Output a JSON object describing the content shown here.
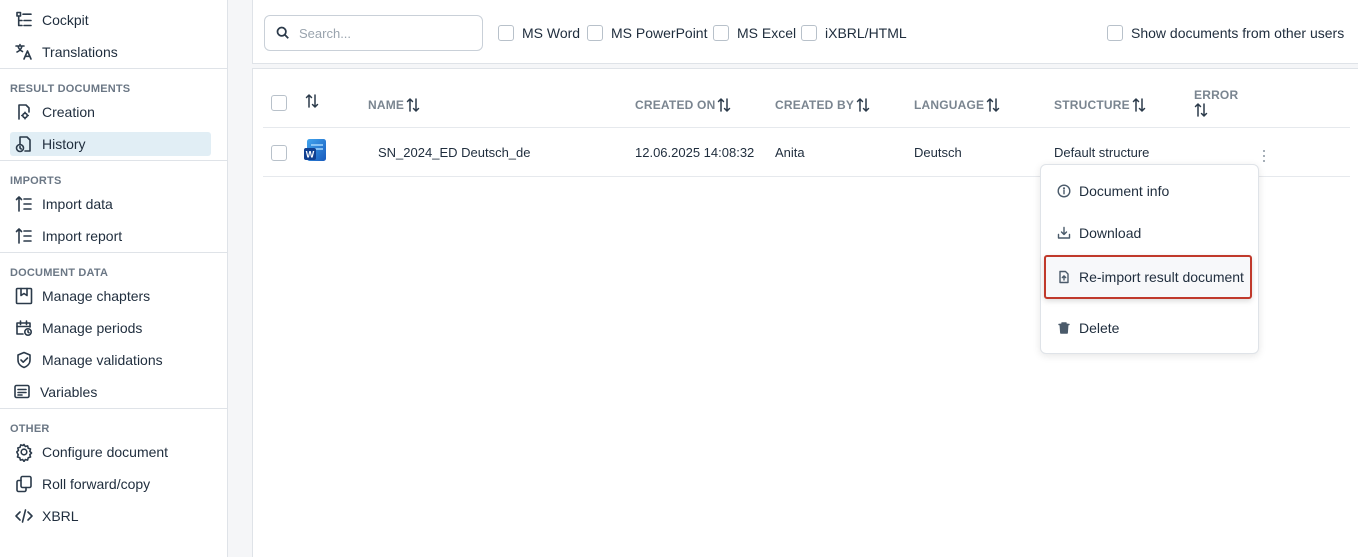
{
  "sidebar": {
    "top_items": [
      {
        "label": "Cockpit",
        "icon": "tree-list-icon"
      },
      {
        "label": "Translations",
        "icon": "translate-icon"
      }
    ],
    "sections": [
      {
        "title": "RESULT DOCUMENTS",
        "items": [
          {
            "label": "Creation",
            "icon": "document-gear-icon"
          },
          {
            "label": "History",
            "icon": "document-history-icon",
            "active": true
          }
        ]
      },
      {
        "title": "IMPORTS",
        "items": [
          {
            "label": "Import data",
            "icon": "import-list-icon"
          },
          {
            "label": "Import report",
            "icon": "import-list-icon"
          }
        ]
      },
      {
        "title": "DOCUMENT DATA",
        "items": [
          {
            "label": "Manage chapters",
            "icon": "bookmark-icon"
          },
          {
            "label": "Manage periods",
            "icon": "calendar-clock-icon"
          },
          {
            "label": "Manage validations",
            "icon": "shield-check-icon"
          },
          {
            "label": "Variables",
            "icon": "variables-icon"
          }
        ]
      },
      {
        "title": "OTHER",
        "items": [
          {
            "label": "Configure document",
            "icon": "gear-icon"
          },
          {
            "label": "Roll forward/copy",
            "icon": "copy-icon"
          },
          {
            "label": "XBRL",
            "icon": "code-icon"
          }
        ]
      }
    ]
  },
  "toolbar": {
    "search_placeholder": "Search...",
    "filters": [
      "MS Word",
      "MS PowerPoint",
      "MS Excel",
      "iXBRL/HTML"
    ],
    "show_other_users": "Show documents from other users"
  },
  "table": {
    "headers": [
      "NAME",
      "CREATED ON",
      "CREATED BY",
      "LANGUAGE",
      "STRUCTURE",
      "ERROR"
    ],
    "rows": [
      {
        "name": "SN_2024_ED Deutsch_de",
        "created_on": "12.06.2025 14:08:32",
        "created_by": "Anita",
        "language": "Deutsch",
        "structure": "Default structure",
        "error": ""
      }
    ]
  },
  "context_menu": {
    "items": [
      {
        "label": "Document info",
        "icon": "info-icon"
      },
      {
        "label": "Download",
        "icon": "download-icon"
      },
      {
        "label": "Re-import result document",
        "icon": "file-upload-icon",
        "highlighted": true
      },
      {
        "label": "Delete",
        "icon": "trash-icon"
      }
    ]
  },
  "colors": {
    "active_bg": "#e1eef5",
    "highlight_border": "#c0392b",
    "word_blue": "#185abd"
  }
}
